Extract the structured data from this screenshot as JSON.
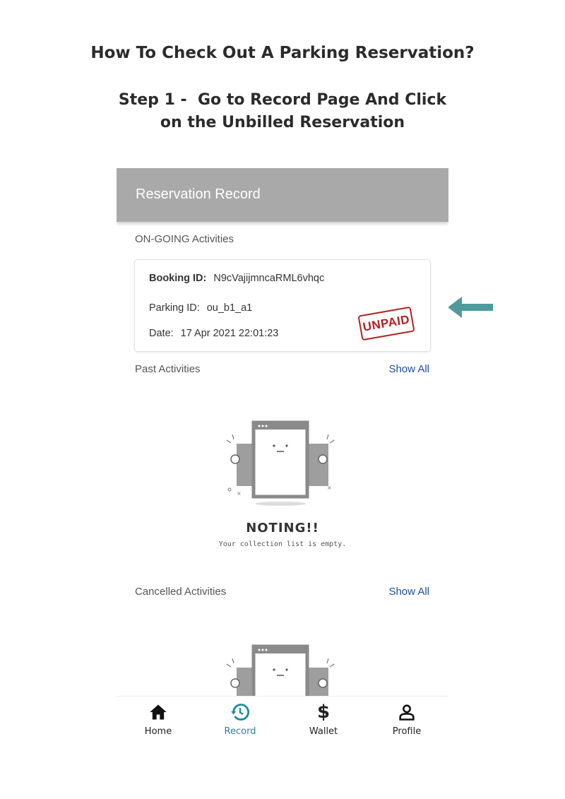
{
  "guide": {
    "title": "How To Check Out A Parking Reservation?",
    "step_line1": "Step 1 -  Go to Record Page And Click",
    "step_line2": "on the Unbilled Reservation"
  },
  "app": {
    "title": "Reservation Record"
  },
  "ongoing": {
    "label": "ON-GOING Activities",
    "booking_id_label": "Booking ID:",
    "booking_id": "N9cVajijmncaRML6vhqc",
    "parking_id_label": "Parking ID:",
    "parking_id": "ou_b1_a1",
    "date_label": "Date:",
    "date": "17 Apr 2021 22:01:23",
    "status_stamp": "UNPAID"
  },
  "past": {
    "label": "Past Activities",
    "show_all": "Show All",
    "empty_title": "NOTING!!",
    "empty_subtitle": "Your collection list is empty."
  },
  "cancelled": {
    "label": "Cancelled Activities",
    "show_all": "Show All"
  },
  "nav": [
    {
      "label": "Home",
      "icon": "home-icon"
    },
    {
      "label": "Record",
      "icon": "history-icon",
      "active": true
    },
    {
      "label": "Wallet",
      "icon": "dollar-icon"
    },
    {
      "label": "Profile",
      "icon": "user-icon"
    }
  ],
  "colors": {
    "appbar": "#a9a9a9",
    "link": "#1f4e9c",
    "active_tab": "#1b8a9e",
    "stamp": "#b22222",
    "arrow": "#4f9a9a"
  }
}
